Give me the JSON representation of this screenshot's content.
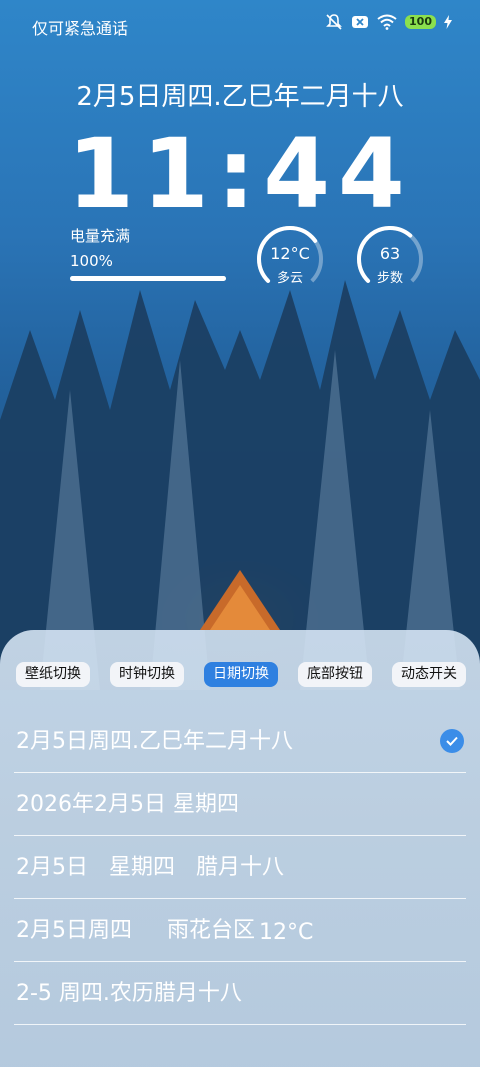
{
  "status": {
    "carrier": "仅可紧急通话",
    "battery": "100"
  },
  "lockscreen": {
    "date": "2月5日周四.乙巳年二月十八",
    "time": "11:44",
    "charge": {
      "label": "电量充满",
      "percent_text": "100%",
      "level": 1.0
    },
    "weather": {
      "temp": "12°C",
      "condition": "多云",
      "level": 0.7
    },
    "steps": {
      "value": "63",
      "label": "步数",
      "level": 0.65
    }
  },
  "sheet": {
    "tabs": [
      {
        "label": "壁纸切换",
        "active": false
      },
      {
        "label": "时钟切换",
        "active": false
      },
      {
        "label": "日期切换",
        "active": true
      },
      {
        "label": "底部按钮",
        "active": false
      },
      {
        "label": "动态开关",
        "active": false
      }
    ],
    "options": [
      {
        "text": "2月5日周四.乙巳年二月十八",
        "selected": true
      },
      {
        "text": "2026年2月5日 星期四",
        "selected": false
      },
      {
        "text": "2月5日   星期四   腊月十八",
        "selected": false
      },
      {
        "text": "2月5日周四     雨花台区",
        "extra": "12°C",
        "selected": false
      },
      {
        "text": "2-5 周四.农历腊月十八",
        "selected": false
      }
    ]
  },
  "colors": {
    "accent": "#2f80e0",
    "battery": "#8be04e"
  }
}
